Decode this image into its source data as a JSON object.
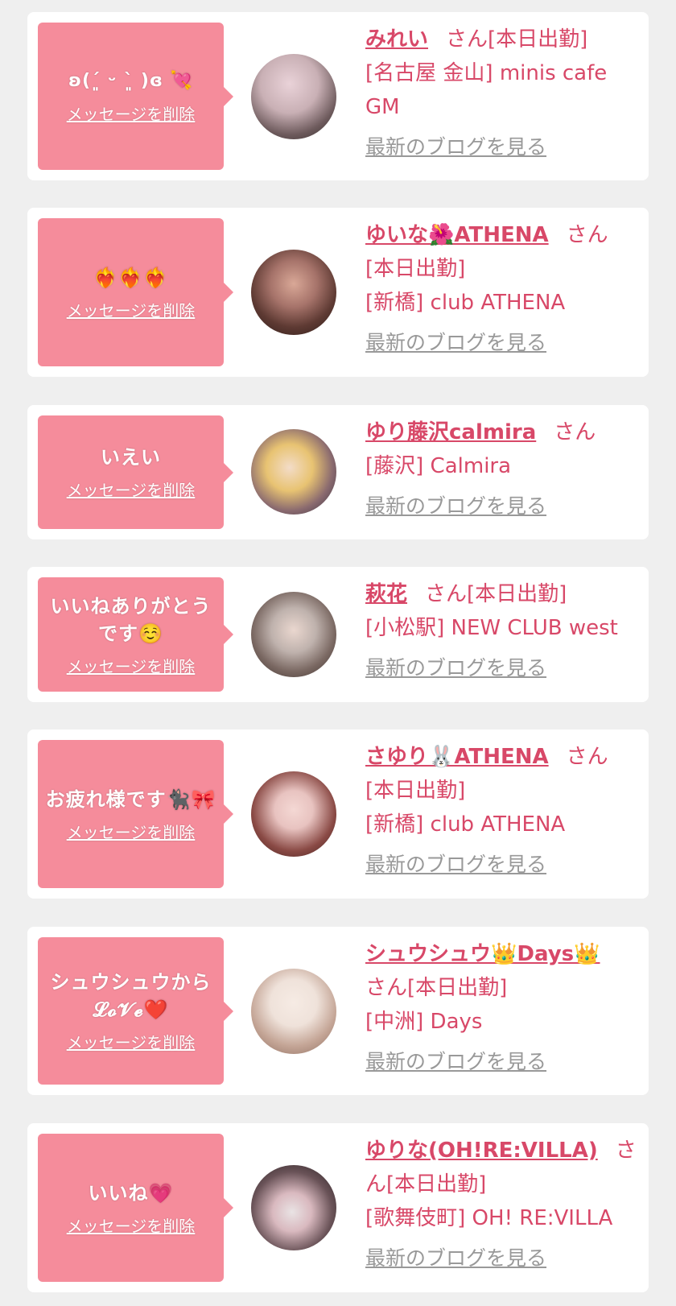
{
  "cards": [
    {
      "message": "ʚ(´͈ ᵕ `͈ )ɞ 💘",
      "delete_label": "メッセージを削除",
      "name": "みれい",
      "san": "さん",
      "status": "[本日出勤]",
      "location": "[名古屋 金山] minis cafe GM",
      "blog_link": "最新のブログを見る",
      "avatar_colors": [
        "#d9c6c9",
        "#3a3333"
      ]
    },
    {
      "message": "❤️‍🔥❤️‍🔥❤️‍🔥",
      "delete_label": "メッセージを削除",
      "name": "ゆいな🌺ATHENA",
      "san": "さん",
      "status": "[本日出勤]",
      "location": "[新橋] club ATHENA",
      "blog_link": "最新のブログを見る",
      "avatar_colors": [
        "#a6736a",
        "#3b2420"
      ]
    },
    {
      "message": "いえい",
      "delete_label": "メッセージを削除",
      "name": "ゆり藤沢calmira",
      "san": "さん",
      "status": "",
      "location": "[藤沢] Calmira",
      "blog_link": "最新のブログを見る",
      "avatar_colors": [
        "#e8c372",
        "#3a3548"
      ]
    },
    {
      "message": "いいねありがとうです☺️",
      "delete_label": "メッセージを削除",
      "name": "萩花",
      "san": "さん",
      "status": "[本日出勤]",
      "location": "[小松駅] NEW CLUB west",
      "blog_link": "最新のブログを見る",
      "avatar_colors": [
        "#bfb2ad",
        "#5a4a45"
      ]
    },
    {
      "message": "お疲れ様です🐈‍⬛🎀",
      "delete_label": "メッセージを削除",
      "name": "さゆり🐰ATHENA",
      "san": "さん",
      "status": "[本日出勤]",
      "location": "[新橋] club ATHENA",
      "blog_link": "最新のブログを見る",
      "avatar_colors": [
        "#e8c3c0",
        "#5b2a28"
      ]
    },
    {
      "message": "シュウシュウから 𝓛𝓸𝓥𝓮❤️",
      "delete_label": "メッセージを削除",
      "name": "シュウシュウ👑Days👑",
      "san": "さん",
      "status": "[本日出勤]",
      "location": "[中洲] Days",
      "blog_link": "最新のブログを見る",
      "avatar_colors": [
        "#efe2da",
        "#b39384"
      ]
    },
    {
      "message": "いいね💗",
      "delete_label": "メッセージを削除",
      "name": "ゆりな(OH!RE:VILLA)",
      "san": "さん",
      "status": "[本日出勤]",
      "location": "[歌舞伎町] OH! RE:VILLA",
      "blog_link": "最新のブログを見る",
      "avatar_colors": [
        "#d9b9bf",
        "#2b2224"
      ]
    }
  ]
}
